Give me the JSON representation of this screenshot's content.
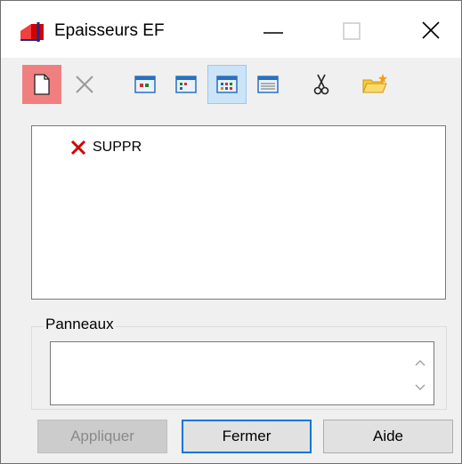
{
  "window": {
    "title": "Epaisseurs EF"
  },
  "titlebar": {
    "icons": [
      "app-icon",
      "minimize-icon",
      "maximize-icon",
      "close-icon"
    ]
  },
  "toolbar": {
    "tools": [
      {
        "name": "new-document",
        "icon": "new-document-icon",
        "state": "hot"
      },
      {
        "name": "delete",
        "icon": "delete-x-icon",
        "state": "disabled"
      },
      {
        "name": "view-1",
        "icon": "view-large-icons-icon",
        "state": "normal"
      },
      {
        "name": "view-2",
        "icon": "view-small-icons-icon",
        "state": "normal"
      },
      {
        "name": "view-3",
        "icon": "view-list-icon",
        "state": "checked"
      },
      {
        "name": "view-4",
        "icon": "view-details-icon",
        "state": "normal"
      },
      {
        "name": "cut",
        "icon": "scissors-icon",
        "state": "normal"
      },
      {
        "name": "open-folder",
        "icon": "folder-star-icon",
        "state": "normal"
      }
    ]
  },
  "list": {
    "items": [
      {
        "label": "SUPPR",
        "icon": "red-x-icon"
      }
    ]
  },
  "panneaux": {
    "group_label": "Panneaux",
    "value": ""
  },
  "buttons": {
    "apply": "Appliquer",
    "close": "Fermer",
    "help": "Aide"
  },
  "colors": {
    "hot_tool_bg": "#f08080",
    "checked_tool_bg": "#cce4f7",
    "default_button_border": "#0078d7"
  }
}
